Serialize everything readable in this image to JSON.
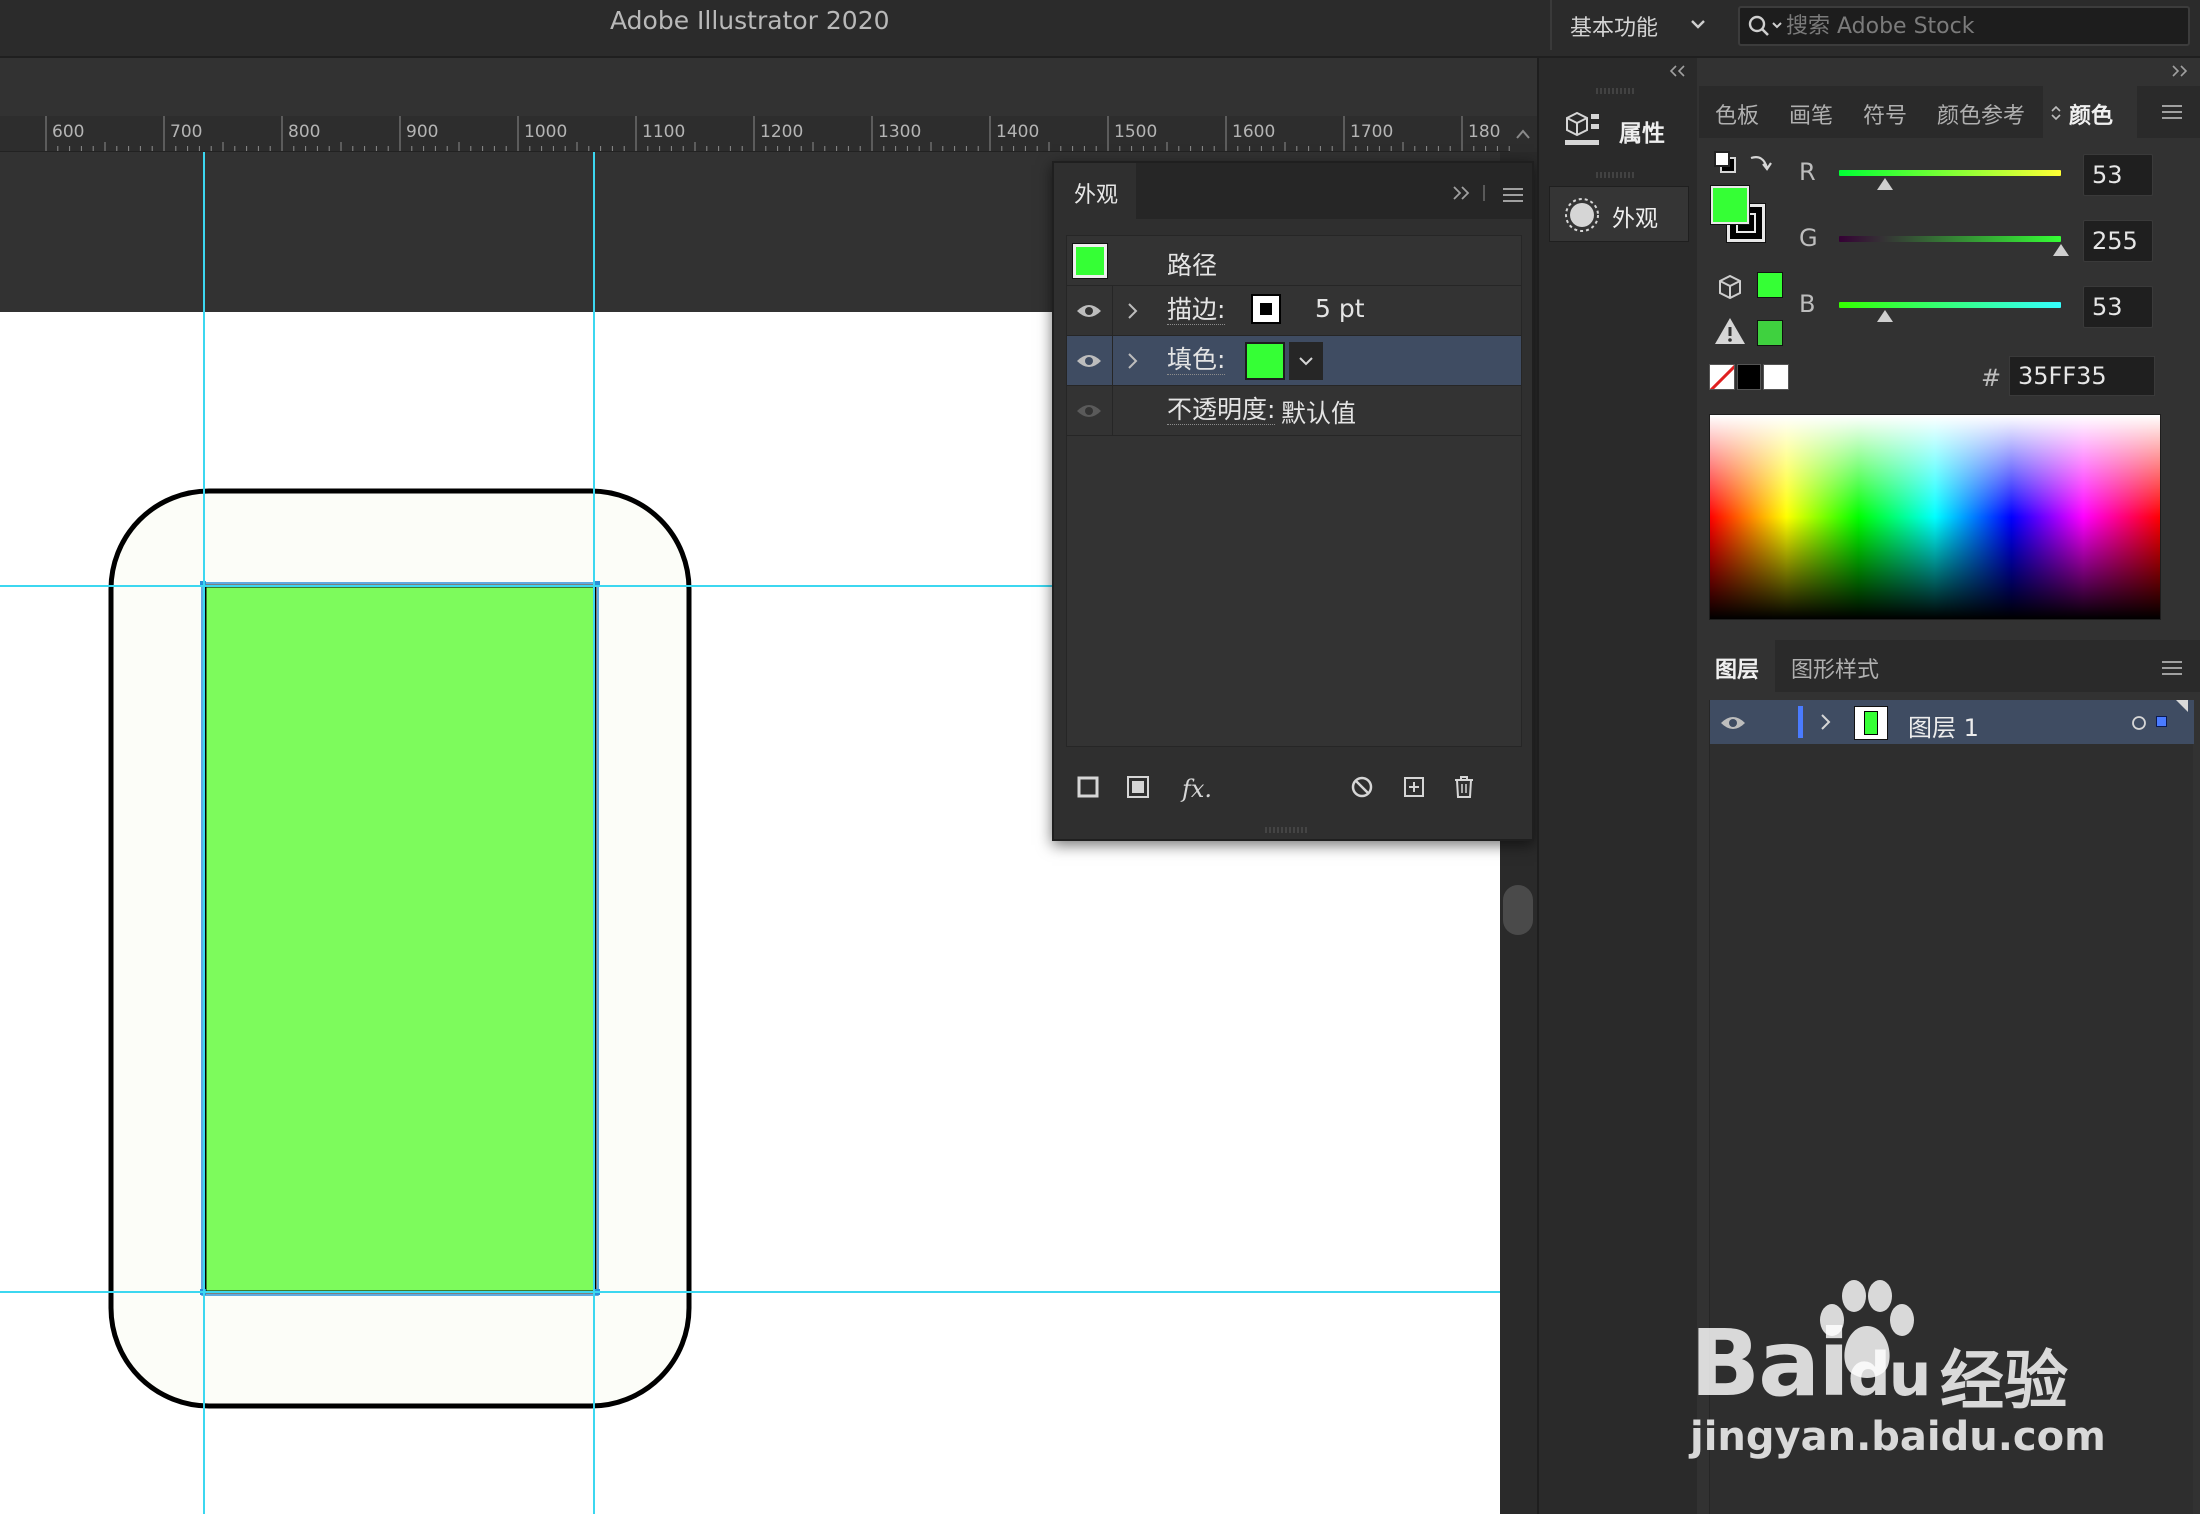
{
  "app": {
    "title": "Adobe Illustrator 2020"
  },
  "workspace": {
    "label": "基本功能"
  },
  "search": {
    "placeholder": "搜索 Adobe Stock"
  },
  "ruler": {
    "ticks": [
      "600",
      "700",
      "800",
      "900",
      "1000",
      "1100",
      "1200",
      "1300",
      "1400",
      "1500",
      "1600",
      "1700",
      "180"
    ]
  },
  "appearance": {
    "tab": "外观",
    "object": "路径",
    "stroke_label": "描边:",
    "stroke_value": "5 pt",
    "fill_label": "填色:",
    "opacity_label": "不透明度:",
    "opacity_value": "默认值",
    "fx": "fx."
  },
  "dock": {
    "properties": "属性",
    "appearance": "外观"
  },
  "color_tabs": [
    "色板",
    "画笔",
    "符号",
    "颜色参考",
    "颜色"
  ],
  "color": {
    "r_label": "R",
    "g_label": "G",
    "b_label": "B",
    "r": "53",
    "g": "255",
    "b": "53",
    "hex_symbol": "#",
    "hex": "35FF35",
    "fill_hex": "#35ff35"
  },
  "layers": {
    "tabs": [
      "图层",
      "图形样式"
    ],
    "row_name": "图层 1"
  },
  "watermark": {
    "brand": "Bai",
    "brand2": "du",
    "cn": "经验",
    "url": "jingyan.baidu.com"
  }
}
